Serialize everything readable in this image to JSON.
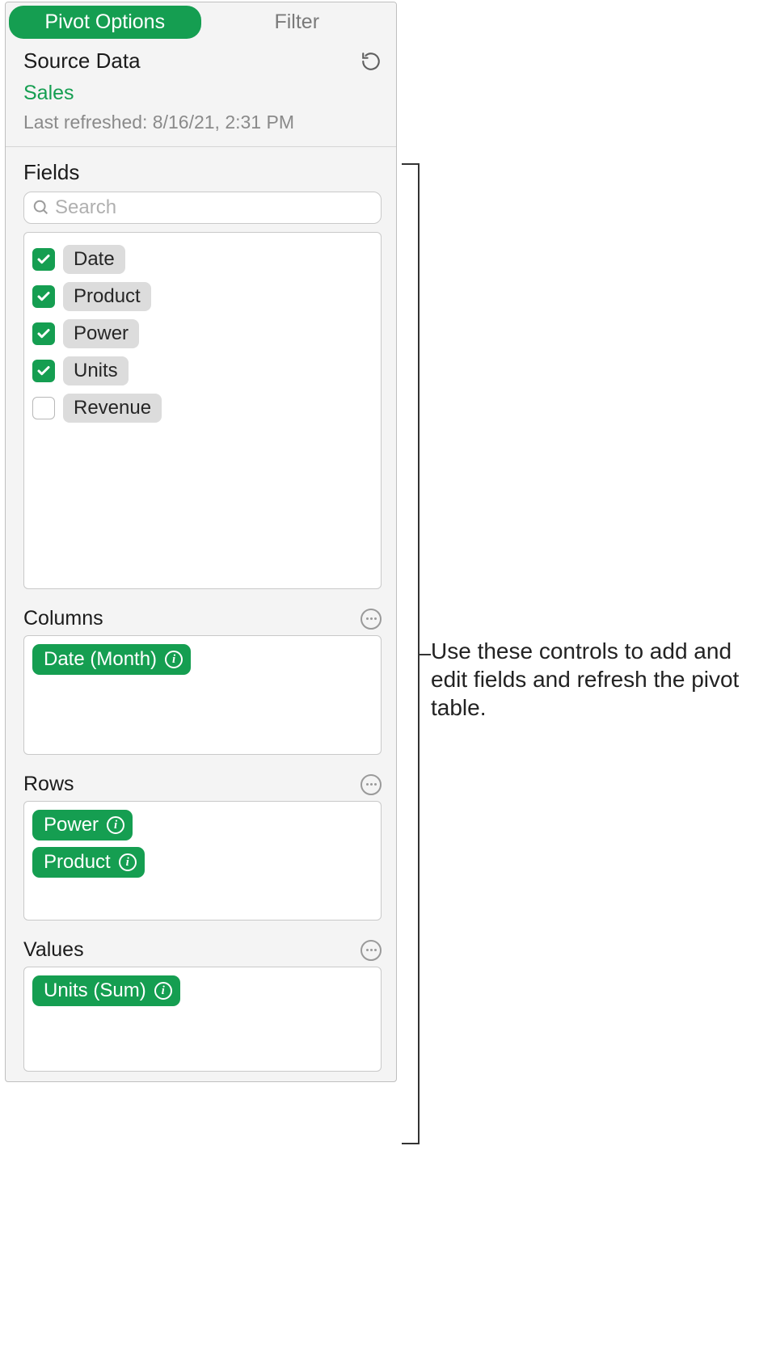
{
  "tabs": {
    "pivot": "Pivot Options",
    "filter": "Filter"
  },
  "source": {
    "title": "Source Data",
    "name": "Sales",
    "last_refreshed": "Last refreshed: 8/16/21, 2:31 PM"
  },
  "fields": {
    "title": "Fields",
    "search_placeholder": "Search",
    "items": [
      {
        "label": "Date",
        "checked": true
      },
      {
        "label": "Product",
        "checked": true
      },
      {
        "label": "Power",
        "checked": true
      },
      {
        "label": "Units",
        "checked": true
      },
      {
        "label": "Revenue",
        "checked": false
      }
    ]
  },
  "columns": {
    "title": "Columns",
    "pills": [
      {
        "label": "Date (Month)"
      }
    ]
  },
  "rows": {
    "title": "Rows",
    "pills": [
      {
        "label": "Power"
      },
      {
        "label": "Product"
      }
    ]
  },
  "values": {
    "title": "Values",
    "pills": [
      {
        "label": "Units (Sum)"
      }
    ]
  },
  "callout": "Use these controls to add and edit fields and refresh the pivot table."
}
